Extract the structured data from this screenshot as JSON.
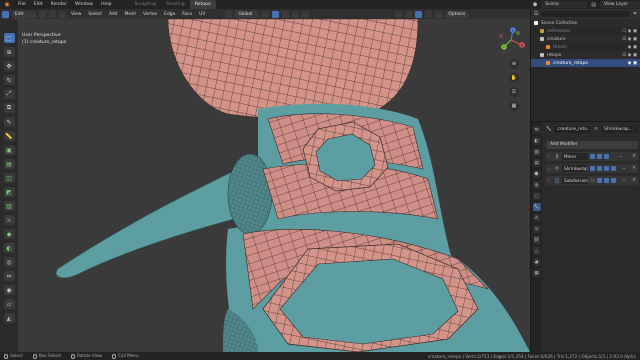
{
  "topbar": {
    "menus": [
      "File",
      "Edit",
      "Render",
      "Window",
      "Help"
    ],
    "workspaces": [
      "Sculpting",
      "Shading",
      "Retopo"
    ],
    "active_workspace": "Retopo",
    "scene": "Scene",
    "view_layer": "View Layer"
  },
  "viewport_header": {
    "mode": "Edit Mode",
    "menus": [
      "View",
      "Select",
      "Add",
      "Mesh",
      "Vertex",
      "Edge",
      "Face",
      "UV"
    ],
    "orientation": "Global",
    "options": "Options"
  },
  "viewport": {
    "perspective": "User Perspective",
    "object": "(1) creature_retopo"
  },
  "gizmo": {
    "x": "X",
    "y": "Y",
    "z": "Z"
  },
  "outliner": {
    "rows": [
      {
        "label": "Scene Collection",
        "color": "#ffffff"
      },
      {
        "label": "references",
        "color": "#c49a3a"
      },
      {
        "label": "creature",
        "color": "#c0c0c0"
      },
      {
        "label": "tmesh",
        "color": "#e88a2e"
      },
      {
        "label": "retopo",
        "color": "#c0c0c0"
      },
      {
        "label": "creature_retopo",
        "color": "#e88a2e"
      }
    ]
  },
  "properties": {
    "object_name": "creature_reto...",
    "modifier_ref": "Shrinkwrap...",
    "add_modifier": "Add Modifier",
    "modifiers": [
      {
        "name": "Mirror",
        "icon": "mirror-icon"
      },
      {
        "name": "Shrinkwrap",
        "icon": "shrinkwrap-icon"
      },
      {
        "name": "Subdivision",
        "icon": "subdivision-icon"
      }
    ]
  },
  "statusbar": {
    "select": "Select",
    "box_select": "Box Select",
    "rotate_view": "Rotate View",
    "call_menu": "Call Menu",
    "stats": "creature_retopo | Verts:2/713 | Edges:1/1,354 | Faces:0/636 | Tris:1,272 | Objects:1/1 | 2.93.0 Alpha"
  },
  "colors": {
    "accent": "#4772b3",
    "mesh_salmon": "#d4948a",
    "body_teal": "#5d9ea3",
    "blender_orange": "#e88a2e"
  }
}
